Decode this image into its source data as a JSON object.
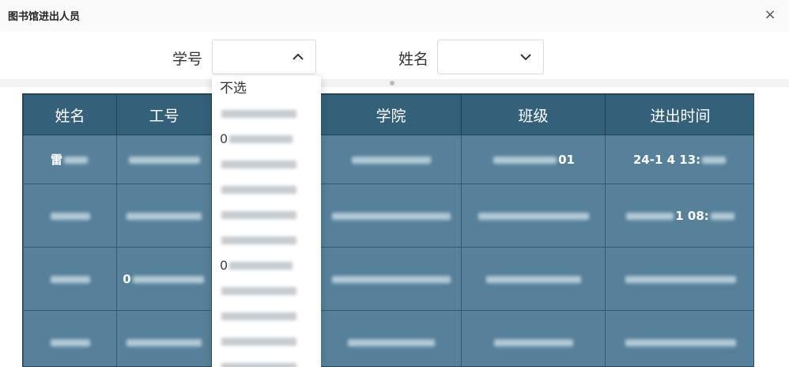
{
  "dialog": {
    "title": "图书馆进出人员",
    "close_glyph": "×"
  },
  "filters": {
    "student_id_label": "学号",
    "name_label": "姓名"
  },
  "table": {
    "headers": [
      "姓名",
      "工号",
      "",
      "学院",
      "班级",
      "进出时间"
    ],
    "rows": [
      {
        "name_hint": "雷",
        "class_hint": "01",
        "time_hint": "24-1  4 13:"
      },
      {
        "name_hint": "",
        "college_hint": "",
        "time_hint": "1 08:"
      },
      {
        "name_hint": "",
        "id_hint": "0"
      },
      {
        "name_hint": ""
      }
    ]
  },
  "dropdown": {
    "items": [
      "不选",
      "",
      "0",
      "",
      "",
      "",
      "",
      "0",
      "",
      "",
      "",
      ""
    ]
  },
  "colors": {
    "header_bg": "#35607a",
    "row_bg": "#57819a"
  }
}
